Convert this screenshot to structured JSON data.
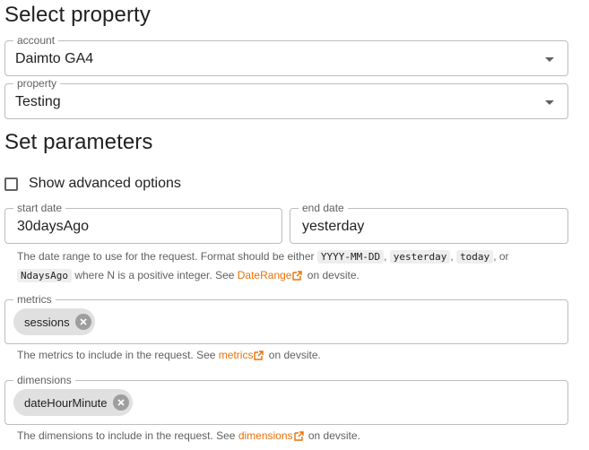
{
  "headings": {
    "select_property": "Select property",
    "set_parameters": "Set parameters"
  },
  "account": {
    "label": "account",
    "value": "Daimto GA4"
  },
  "property": {
    "label": "property",
    "value": "Testing"
  },
  "advanced": {
    "label": "Show advanced options",
    "checked": false
  },
  "start_date": {
    "label": "start date",
    "value": "30daysAgo"
  },
  "end_date": {
    "label": "end date",
    "value": "yesterday"
  },
  "date_helper": {
    "t1": "The date range to use for the request. Format should be either ",
    "c1": "YYYY-MM-DD",
    "s1": ", ",
    "c2": "yesterday",
    "s2": ", ",
    "c3": "today",
    "s3": ", or",
    "c4": "NdaysAgo",
    "t2": " where N is a positive integer. See ",
    "link": "DateRange",
    "t3": " on devsite."
  },
  "metrics": {
    "label": "metrics",
    "chips": [
      "sessions"
    ],
    "helper_prefix": "The metrics to include in the request. See ",
    "helper_link": "metrics",
    "helper_suffix": " on devsite."
  },
  "dimensions": {
    "label": "dimensions",
    "chips": [
      "dateHourMinute"
    ],
    "helper_prefix": "The dimensions to include in the request. See ",
    "helper_link": "dimensions",
    "helper_suffix": " on devsite."
  },
  "colors": {
    "link": "#e8710a",
    "border": "#bdbdbd",
    "chip": "#e0e0e0"
  },
  "icons": [
    "dropdown-caret-icon",
    "checkbox-icon",
    "external-link-icon",
    "chip-remove-icon"
  ]
}
